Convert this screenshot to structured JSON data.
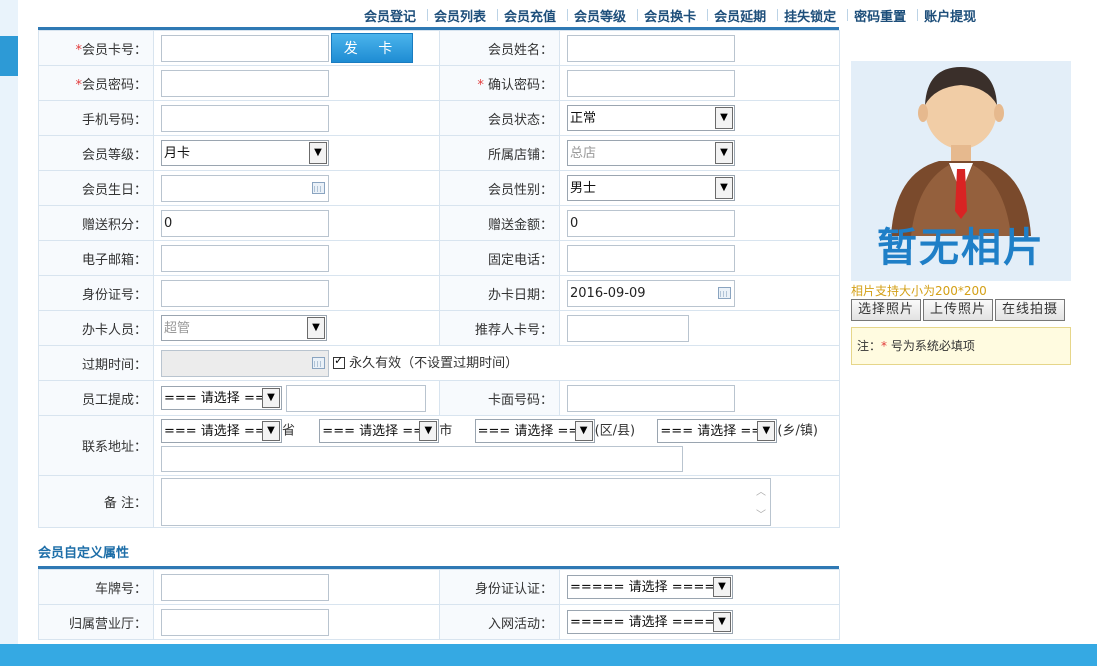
{
  "nav": [
    "会员登记",
    "会员列表",
    "会员充值",
    "会员等级",
    "会员换卡",
    "会员延期",
    "挂失锁定",
    "密码重置",
    "账户提现"
  ],
  "issue_button": "发 卡",
  "fields": {
    "card_no": {
      "label": "会员卡号：",
      "value": ""
    },
    "name": {
      "label": "会员姓名：",
      "value": ""
    },
    "password": {
      "label": "会员密码：",
      "value": ""
    },
    "confirm_password": {
      "label": "确认密码：",
      "value": ""
    },
    "mobile": {
      "label": "手机号码：",
      "value": ""
    },
    "status": {
      "label": "会员状态：",
      "value": "正常"
    },
    "level": {
      "label": "会员等级：",
      "value": "月卡"
    },
    "store": {
      "label": "所属店铺：",
      "value": "总店"
    },
    "birthday": {
      "label": "会员生日：",
      "value": ""
    },
    "gender": {
      "label": "会员性别：",
      "value": "男士"
    },
    "bonus_points": {
      "label": "赠送积分：",
      "value": "0"
    },
    "bonus_amount": {
      "label": "赠送金额：",
      "value": "0"
    },
    "email": {
      "label": "电子邮箱：",
      "value": ""
    },
    "phone": {
      "label": "固定电话：",
      "value": ""
    },
    "id_card": {
      "label": "身份证号：",
      "value": ""
    },
    "issue_date": {
      "label": "办卡日期：",
      "value": "2016-09-09"
    },
    "operator": {
      "label": "办卡人员：",
      "value": "超管"
    },
    "referrer": {
      "label": "推荐人卡号：",
      "value": ""
    },
    "expire": {
      "label": "过期时间：",
      "value": "",
      "permanent_label": "永久有效（不设置过期时间）"
    },
    "commission": {
      "label": "员工提成：",
      "select": "=== 请选择 ===",
      "value": ""
    },
    "face_no": {
      "label": "卡面号码：",
      "value": ""
    },
    "address": {
      "label": "联系地址：",
      "province": "=== 请选择 ===",
      "province_suffix": "省",
      "city": "=== 请选择 ===",
      "city_suffix": "市",
      "district": "=== 请选择 ===",
      "district_suffix": "(区/县)",
      "town": "=== 请选择 ===",
      "town_suffix": "(乡/镇)",
      "detail": ""
    },
    "remark": {
      "label": "备 注：",
      "value": ""
    }
  },
  "custom_section": {
    "title": "会员自定义属性",
    "plate": {
      "label": "车牌号：",
      "value": ""
    },
    "id_verify": {
      "label": "身份证认证：",
      "value": "===== 请选择 ====="
    },
    "branch": {
      "label": "归属营业厅：",
      "value": ""
    },
    "activity": {
      "label": "入网活动：",
      "value": "===== 请选择 ====="
    }
  },
  "photo": {
    "placeholder_text": "暂无相片",
    "size_hint": "相片支持大小为200*200",
    "buttons": [
      "选择照片",
      "上传照片",
      "在线拍摄"
    ],
    "note_prefix": "注：",
    "note_star": "*",
    "note_text": " 号为系统必填项"
  },
  "required_mark": "*",
  "colors": {
    "accent": "#2f79b4",
    "button": "#1e8cd3",
    "required": "#e23b3b"
  }
}
